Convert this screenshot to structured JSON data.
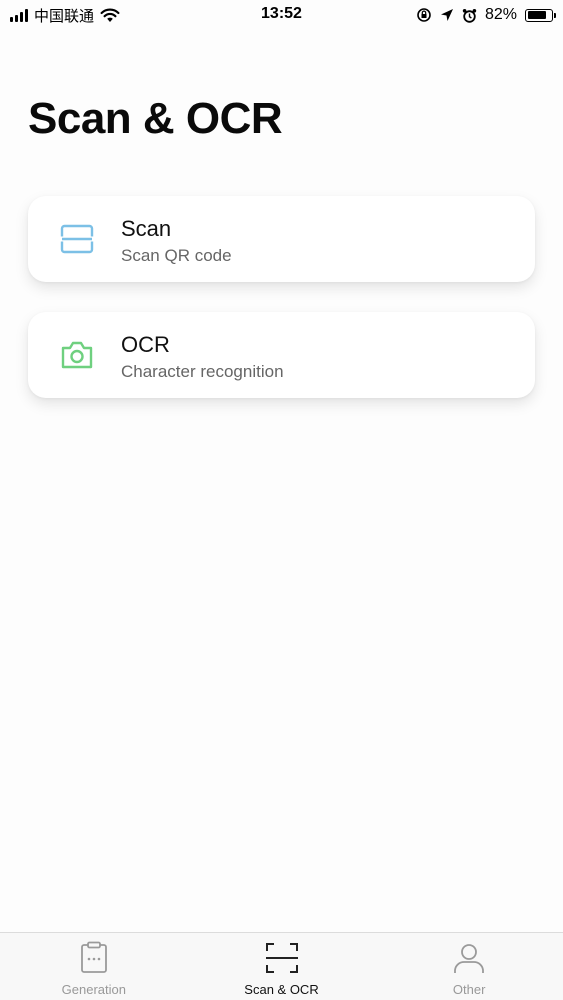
{
  "status_bar": {
    "carrier": "中国联通",
    "time": "13:52",
    "battery": "82%",
    "battery_level": 0.82,
    "icons": [
      "signal-icon",
      "wifi-icon",
      "orientation-lock-icon",
      "location-icon",
      "alarm-icon",
      "battery-icon"
    ]
  },
  "page": {
    "title": "Scan & OCR"
  },
  "colors": {
    "scan_accent": "#7cc0e6",
    "ocr_accent": "#6fd07f",
    "tab_active": "#111111",
    "tab_inactive": "#999999"
  },
  "cards": [
    {
      "title": "Scan",
      "subtitle": "Scan QR code",
      "icon": "scan-icon"
    },
    {
      "title": "OCR",
      "subtitle": "Character recognition",
      "icon": "camera-icon"
    }
  ],
  "tab_bar": {
    "tabs": [
      {
        "label": "Generation",
        "icon": "clipboard-icon",
        "active": false
      },
      {
        "label": "Scan & OCR",
        "icon": "scan-frame-icon",
        "active": true
      },
      {
        "label": "Other",
        "icon": "person-icon",
        "active": false
      }
    ]
  }
}
